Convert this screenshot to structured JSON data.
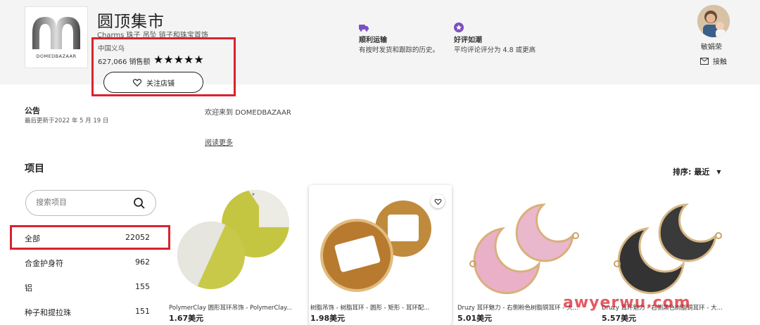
{
  "shop": {
    "name": "圆顶集市",
    "tagline": "Charms 珠子 吊坠 链子和珠宝首饰",
    "logo_text": "DOMEDBAZAAR",
    "location": "中国义乌",
    "sales": "627,066 销售额",
    "stars": "★★★★★",
    "rating_value": 5,
    "follow_label": "关注店铺"
  },
  "features": [
    {
      "icon": "truck-icon",
      "title": "顺利运输",
      "desc": "有按时发货和跟踪的历史。",
      "color": "#7b4fbf"
    },
    {
      "icon": "star-badge-icon",
      "title": "好评如潮",
      "desc": "平均评论评分为 4.8 或更高",
      "color": "#7b4fbf"
    }
  ],
  "owner": {
    "name": "敏娟荣",
    "contact_label": "接触"
  },
  "announcement": {
    "title": "公告",
    "date": "最后更新于2022 年 5 月 19 日",
    "welcome": "欢迎来到 DOMEDBAZAAR",
    "read_more": "阅读更多"
  },
  "items": {
    "title": "项目",
    "sort_label": "排序:",
    "sort_value": "最近",
    "search_placeholder": "搜索项目",
    "categories": [
      {
        "label": "全部",
        "count": "22052"
      },
      {
        "label": "合金护身符",
        "count": "962"
      },
      {
        "label": "铝",
        "count": "155"
      },
      {
        "label": "种子和提拉珠",
        "count": "151"
      }
    ]
  },
  "products": [
    {
      "name": "PolymerClay 圆形耳环吊饰 - PolymerClay...",
      "price": "1.67美元"
    },
    {
      "name": "树脂吊饰 - 树脂耳环 - 圆形 - 矩形 - 耳环配...",
      "price": "1.98美元"
    },
    {
      "name": "Druzy 耳环魅力 - 右侧粉色树脂铜耳环 - 大...",
      "price": "5.01美元"
    },
    {
      "name": "Druzy 耳环魅力 - 右侧黑色树脂铜耳环 - 大...",
      "price": "5.57美元"
    }
  ],
  "watermark": "awyerwu.com",
  "colors": {
    "highlight": "#d9232e",
    "accent": "#7b4fbf",
    "header_bg": "#f4f4f4"
  }
}
